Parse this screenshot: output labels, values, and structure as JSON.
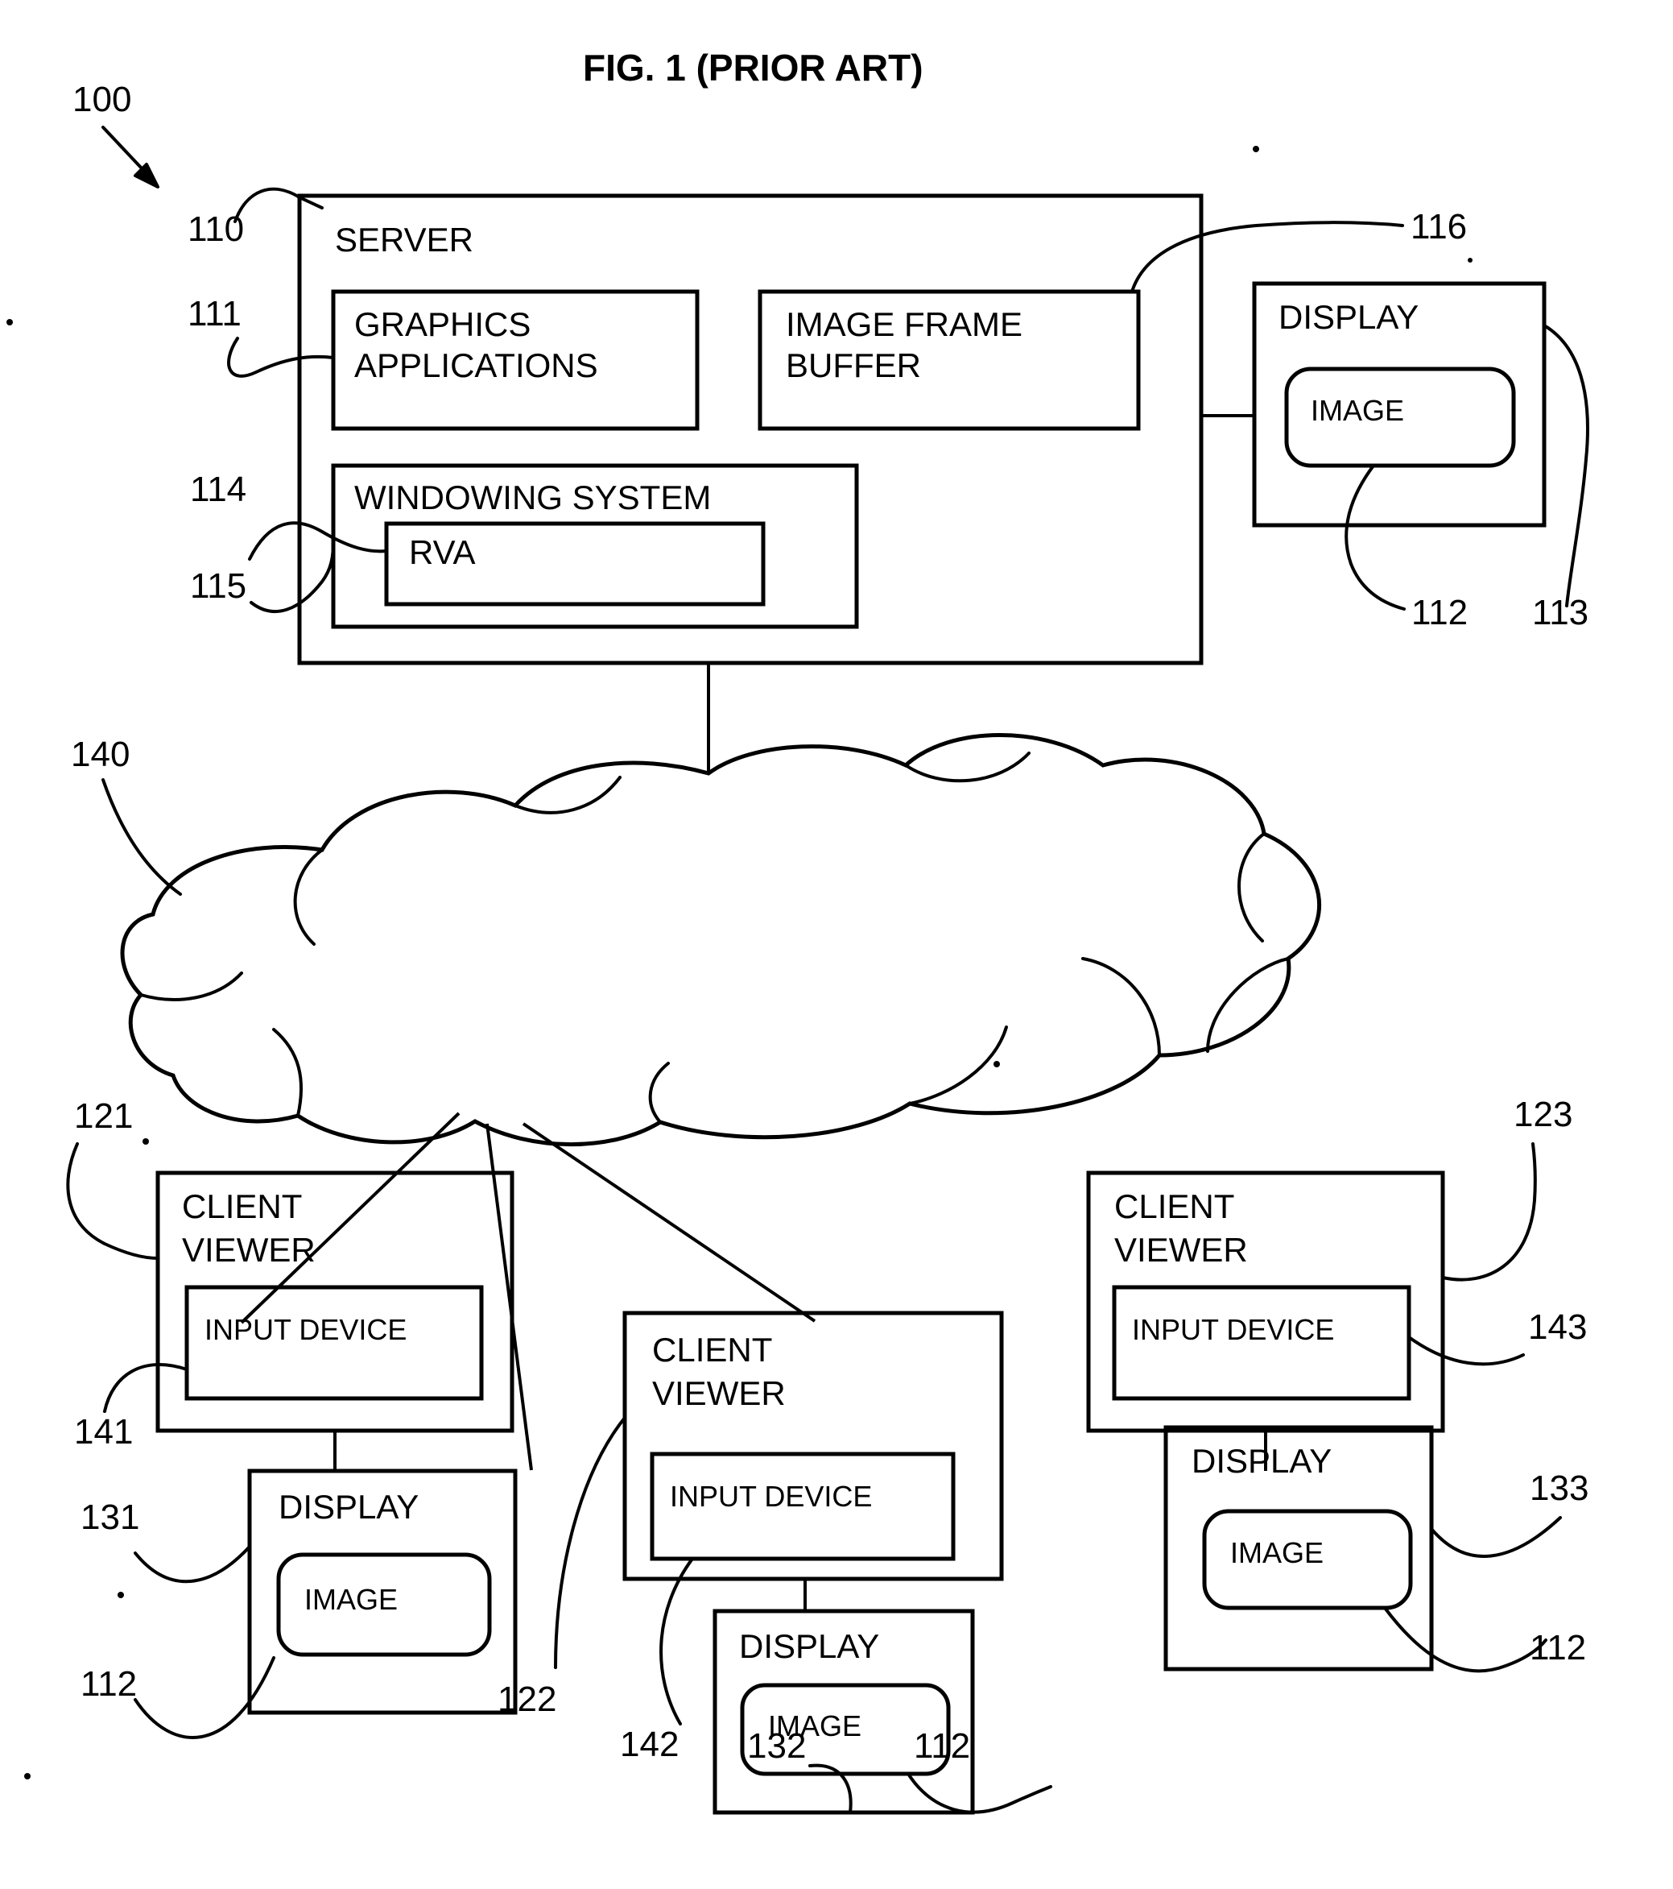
{
  "figure": {
    "title": "FIG. 1 (PRIOR ART)",
    "system_ref": "100"
  },
  "server": {
    "label": "SERVER",
    "ref": "110",
    "graphics_applications": {
      "label_line1": "GRAPHICS",
      "label_line2": "APPLICATIONS",
      "ref": "111"
    },
    "image_frame_buffer": {
      "label_line1": "IMAGE FRAME",
      "label_line2": "BUFFER",
      "ref": "116"
    },
    "windowing_system": {
      "label": "WINDOWING SYSTEM",
      "ref": "114",
      "rva": {
        "label": "RVA",
        "ref": "115"
      }
    }
  },
  "server_display": {
    "label": "DISPLAY",
    "ref": "113",
    "image": {
      "label": "IMAGE",
      "ref": "112"
    }
  },
  "network": {
    "label": "",
    "ref": "140"
  },
  "clients": [
    {
      "label_line1": "CLIENT",
      "label_line2": "VIEWER",
      "ref": "121",
      "input_device": {
        "label": "INPUT DEVICE",
        "ref": "141"
      },
      "display": {
        "label": "DISPLAY",
        "ref": "131",
        "image": {
          "label": "IMAGE",
          "ref": "112"
        }
      }
    },
    {
      "label_line1": "CLIENT",
      "label_line2": "VIEWER",
      "ref": "122",
      "input_device": {
        "label": "INPUT DEVICE",
        "ref": "142"
      },
      "display": {
        "label": "DISPLAY",
        "ref": "132",
        "image": {
          "label": "IMAGE",
          "ref": "112"
        }
      }
    },
    {
      "label_line1": "CLIENT",
      "label_line2": "VIEWER",
      "ref": "123",
      "input_device": {
        "label": "INPUT DEVICE",
        "ref": "143"
      },
      "display": {
        "label": "DISPLAY",
        "ref": "133",
        "image": {
          "label": "IMAGE",
          "ref": "112"
        }
      }
    }
  ]
}
